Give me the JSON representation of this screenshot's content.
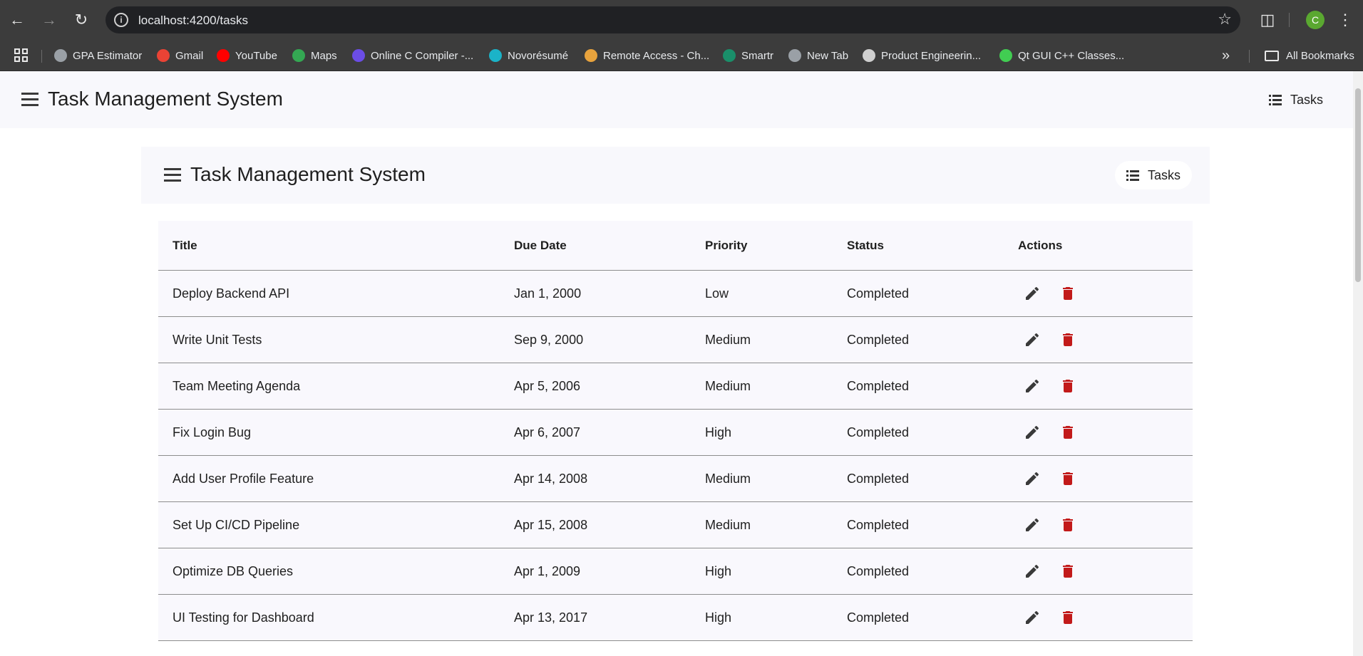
{
  "browser": {
    "url": "localhost:4200/tasks",
    "profile_initial": "C",
    "bookmarks": [
      {
        "label": "GPA Estimator",
        "color": "#9aa0a6"
      },
      {
        "label": "Gmail",
        "color": "#ea4335"
      },
      {
        "label": "YouTube",
        "color": "#ff0000"
      },
      {
        "label": "Maps",
        "color": "#34a853"
      },
      {
        "label": "Online C Compiler -...",
        "color": "#6b4de6"
      },
      {
        "label": "Novorésumé",
        "color": "#1bb3c8"
      },
      {
        "label": "Remote Access - Ch...",
        "color": "#e8a33d"
      },
      {
        "label": "Smartr",
        "color": "#1a8f6a"
      },
      {
        "label": "New Tab",
        "color": "#9aa0a6"
      },
      {
        "label": "Product Engineerin...",
        "color": "#cfcfcf"
      },
      {
        "label": "Qt GUI C++ Classes...",
        "color": "#41cd52"
      }
    ],
    "all_bookmarks": "All Bookmarks"
  },
  "app": {
    "title": "Task Management System",
    "nav_tasks": "Tasks"
  },
  "inner": {
    "title": "Task Management System",
    "nav_tasks": "Tasks"
  },
  "table": {
    "headers": {
      "title": "Title",
      "due": "Due Date",
      "priority": "Priority",
      "status": "Status",
      "actions": "Actions"
    },
    "rows": [
      {
        "title": "Deploy Backend API",
        "due": "Jan 1, 2000",
        "priority": "Low",
        "status": "Completed"
      },
      {
        "title": "Write Unit Tests",
        "due": "Sep 9, 2000",
        "priority": "Medium",
        "status": "Completed"
      },
      {
        "title": "Team Meeting Agenda",
        "due": "Apr 5, 2006",
        "priority": "Medium",
        "status": "Completed"
      },
      {
        "title": "Fix Login Bug",
        "due": "Apr 6, 2007",
        "priority": "High",
        "status": "Completed"
      },
      {
        "title": "Add User Profile Feature",
        "due": "Apr 14, 2008",
        "priority": "Medium",
        "status": "Completed"
      },
      {
        "title": "Set Up CI/CD Pipeline",
        "due": "Apr 15, 2008",
        "priority": "Medium",
        "status": "Completed"
      },
      {
        "title": "Optimize DB Queries",
        "due": "Apr 1, 2009",
        "priority": "High",
        "status": "Completed"
      },
      {
        "title": "UI Testing for Dashboard",
        "due": "Apr 13, 2017",
        "priority": "High",
        "status": "Completed"
      }
    ]
  },
  "colors": {
    "edit_icon": "#3a3a3a",
    "delete_icon": "#c21a1a"
  }
}
